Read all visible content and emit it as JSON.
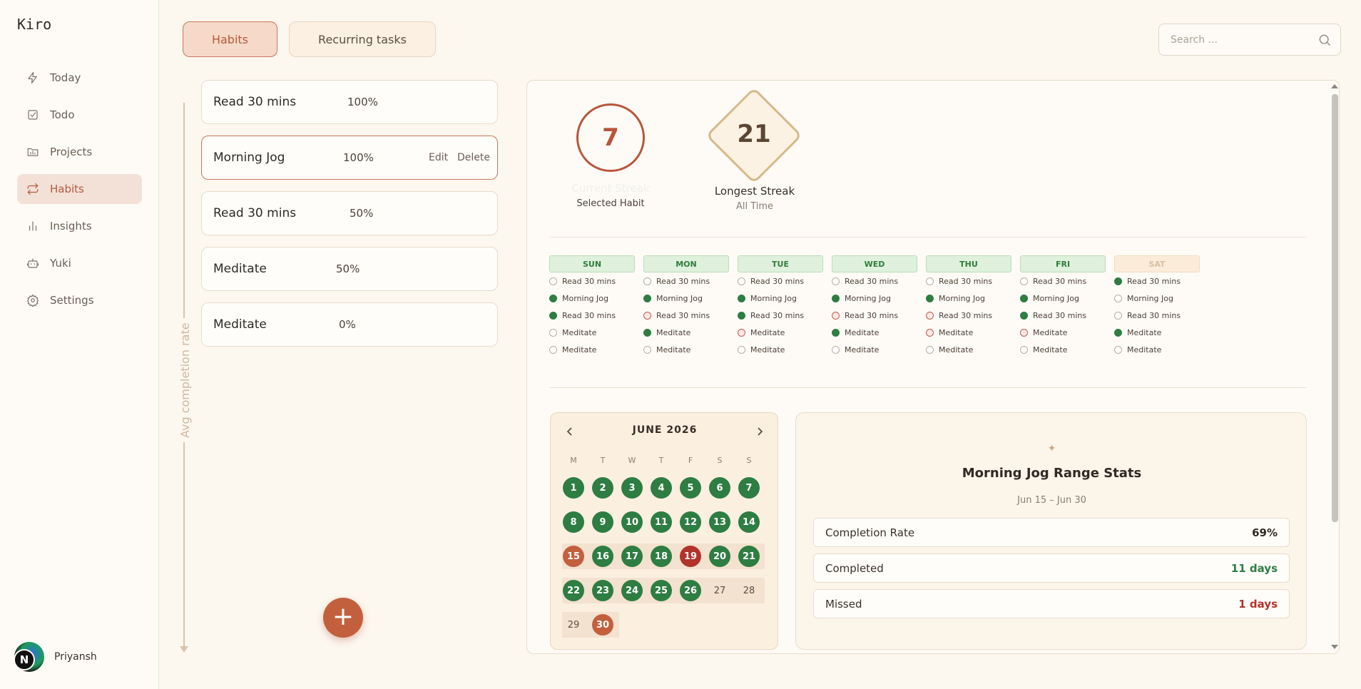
{
  "app": {
    "brand": "Kiro"
  },
  "sidebar": {
    "items": [
      {
        "label": "Today",
        "icon": "bolt-icon"
      },
      {
        "label": "Todo",
        "icon": "checkbox-icon"
      },
      {
        "label": "Projects",
        "icon": "folder-icon"
      },
      {
        "label": "Habits",
        "icon": "repeat-icon",
        "active": true
      },
      {
        "label": "Insights",
        "icon": "bar-chart-icon"
      },
      {
        "label": "Yuki",
        "icon": "robot-icon"
      },
      {
        "label": "Settings",
        "icon": "gear-icon"
      }
    ],
    "user": {
      "name": "Priyansh",
      "initial": "N"
    }
  },
  "tabs": {
    "habits": "Habits",
    "recurring": "Recurring tasks"
  },
  "search": {
    "placeholder": "Search ..."
  },
  "axis": {
    "label": "Avg completion rate"
  },
  "habits": [
    {
      "name": "Read 30 mins",
      "pct": "100%"
    },
    {
      "name": "Morning Jog",
      "pct": "100%",
      "selected": true,
      "edit": "Edit",
      "delete": "Delete"
    },
    {
      "name": "Read 30 mins",
      "pct": "50%"
    },
    {
      "name": "Meditate",
      "pct": "50%"
    },
    {
      "name": "Meditate",
      "pct": "0%"
    }
  ],
  "fab": {
    "label": "+"
  },
  "streak": {
    "current": "7",
    "current_label": "Current Streak",
    "current_sub": "Selected Habit",
    "longest": "21",
    "longest_label": "Longest Streak",
    "longest_sub": "All Time"
  },
  "week": {
    "days": [
      {
        "name": "SUN",
        "entries": [
          [
            "Read 30 mins",
            "empty"
          ],
          [
            "Morning Jog",
            "done"
          ],
          [
            "Read 30 mins",
            "done"
          ],
          [
            "Meditate",
            "empty"
          ],
          [
            "Meditate",
            "empty"
          ]
        ]
      },
      {
        "name": "MON",
        "entries": [
          [
            "Read 30 mins",
            "empty"
          ],
          [
            "Morning Jog",
            "done"
          ],
          [
            "Read 30 mins",
            "missed"
          ],
          [
            "Meditate",
            "done"
          ],
          [
            "Meditate",
            "empty"
          ]
        ]
      },
      {
        "name": "TUE",
        "entries": [
          [
            "Read 30 mins",
            "empty"
          ],
          [
            "Morning Jog",
            "done"
          ],
          [
            "Read 30 mins",
            "done"
          ],
          [
            "Meditate",
            "missed"
          ],
          [
            "Meditate",
            "empty"
          ]
        ]
      },
      {
        "name": "WED",
        "entries": [
          [
            "Read 30 mins",
            "empty"
          ],
          [
            "Morning Jog",
            "done"
          ],
          [
            "Read 30 mins",
            "missed"
          ],
          [
            "Meditate",
            "done"
          ],
          [
            "Meditate",
            "empty"
          ]
        ]
      },
      {
        "name": "THU",
        "entries": [
          [
            "Read 30 mins",
            "empty"
          ],
          [
            "Morning Jog",
            "done"
          ],
          [
            "Read 30 mins",
            "missed"
          ],
          [
            "Meditate",
            "missed"
          ],
          [
            "Meditate",
            "empty"
          ]
        ]
      },
      {
        "name": "FRI",
        "entries": [
          [
            "Read 30 mins",
            "empty"
          ],
          [
            "Morning Jog",
            "done"
          ],
          [
            "Read 30 mins",
            "done"
          ],
          [
            "Meditate",
            "missed"
          ],
          [
            "Meditate",
            "empty"
          ]
        ]
      },
      {
        "name": "SAT",
        "entries": [
          [
            "Read 30 mins",
            "done"
          ],
          [
            "Morning Jog",
            "empty"
          ],
          [
            "Read 30 mins",
            "empty"
          ],
          [
            "Meditate",
            "done"
          ],
          [
            "Meditate",
            "empty"
          ]
        ],
        "muted": true
      }
    ]
  },
  "calendar": {
    "title": "JUNE 2026",
    "weekdays": [
      "M",
      "T",
      "W",
      "T",
      "F",
      "S",
      "S"
    ],
    "days": [
      [
        "1",
        "g"
      ],
      [
        "2",
        "g"
      ],
      [
        "3",
        "g"
      ],
      [
        "4",
        "g"
      ],
      [
        "5",
        "g"
      ],
      [
        "6",
        "g"
      ],
      [
        "7",
        "g"
      ],
      [
        "8",
        "g"
      ],
      [
        "9",
        "g"
      ],
      [
        "10",
        "g"
      ],
      [
        "11",
        "g"
      ],
      [
        "12",
        "g"
      ],
      [
        "13",
        "g"
      ],
      [
        "14",
        "g"
      ],
      [
        "15",
        "o"
      ],
      [
        "16",
        "g"
      ],
      [
        "17",
        "g"
      ],
      [
        "18",
        "g"
      ],
      [
        "19",
        "r"
      ],
      [
        "20",
        "g"
      ],
      [
        "21",
        "g"
      ],
      [
        "22",
        "g"
      ],
      [
        "23",
        "g"
      ],
      [
        "24",
        "g"
      ],
      [
        "25",
        "g"
      ],
      [
        "26",
        "g"
      ],
      [
        "27",
        "n"
      ],
      [
        "28",
        "n"
      ],
      [
        "29",
        "n"
      ],
      [
        "30",
        "o"
      ]
    ]
  },
  "stats": {
    "spark": "✦",
    "title": "Morning Jog Range Stats",
    "range": "Jun 15 – Jun 30",
    "rows": [
      {
        "label": "Completion Rate",
        "value": "69%",
        "color": "#2f2a25"
      },
      {
        "label": "Completed",
        "value": "11 days",
        "color": "#2e7d43"
      },
      {
        "label": "Missed",
        "value": "1 days",
        "color": "#b3322a"
      }
    ]
  }
}
